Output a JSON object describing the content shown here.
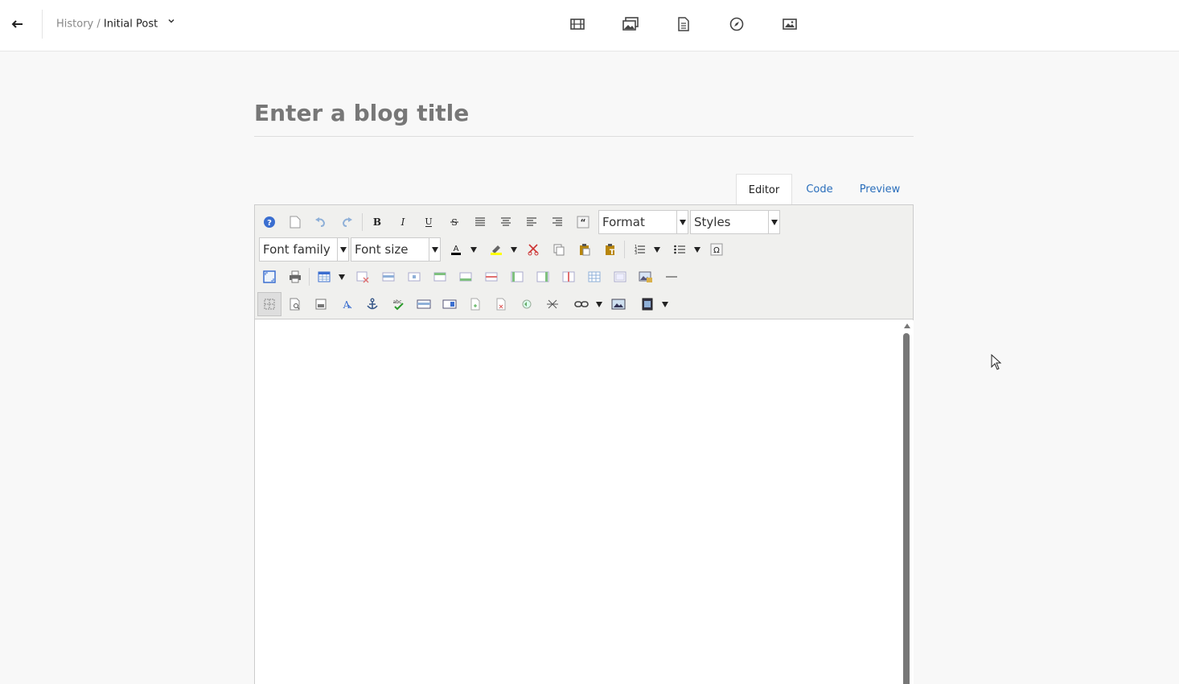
{
  "header": {
    "back_icon": "arrow-left-icon",
    "breadcrumb_parent": "History",
    "breadcrumb_sep": " / ",
    "breadcrumb_current": "Initial Post",
    "chevron_icon": "chevron-down-icon",
    "nav_icons": [
      "film-icon",
      "gallery-icon",
      "page-icon",
      "compass-icon",
      "image-icon"
    ]
  },
  "title": {
    "placeholder": "Enter a blog title",
    "value": ""
  },
  "tabs": [
    {
      "label": "Editor",
      "active": true
    },
    {
      "label": "Code",
      "active": false
    },
    {
      "label": "Preview",
      "active": false
    }
  ],
  "toolbar": {
    "format_label": "Format",
    "styles_label": "Styles",
    "font_family_label": "Font family",
    "font_size_label": "Font size",
    "colors": {
      "text_color": "#000000",
      "highlight": "#ffff00",
      "accent": "#2a6ebb"
    }
  },
  "editor": {
    "content": ""
  }
}
